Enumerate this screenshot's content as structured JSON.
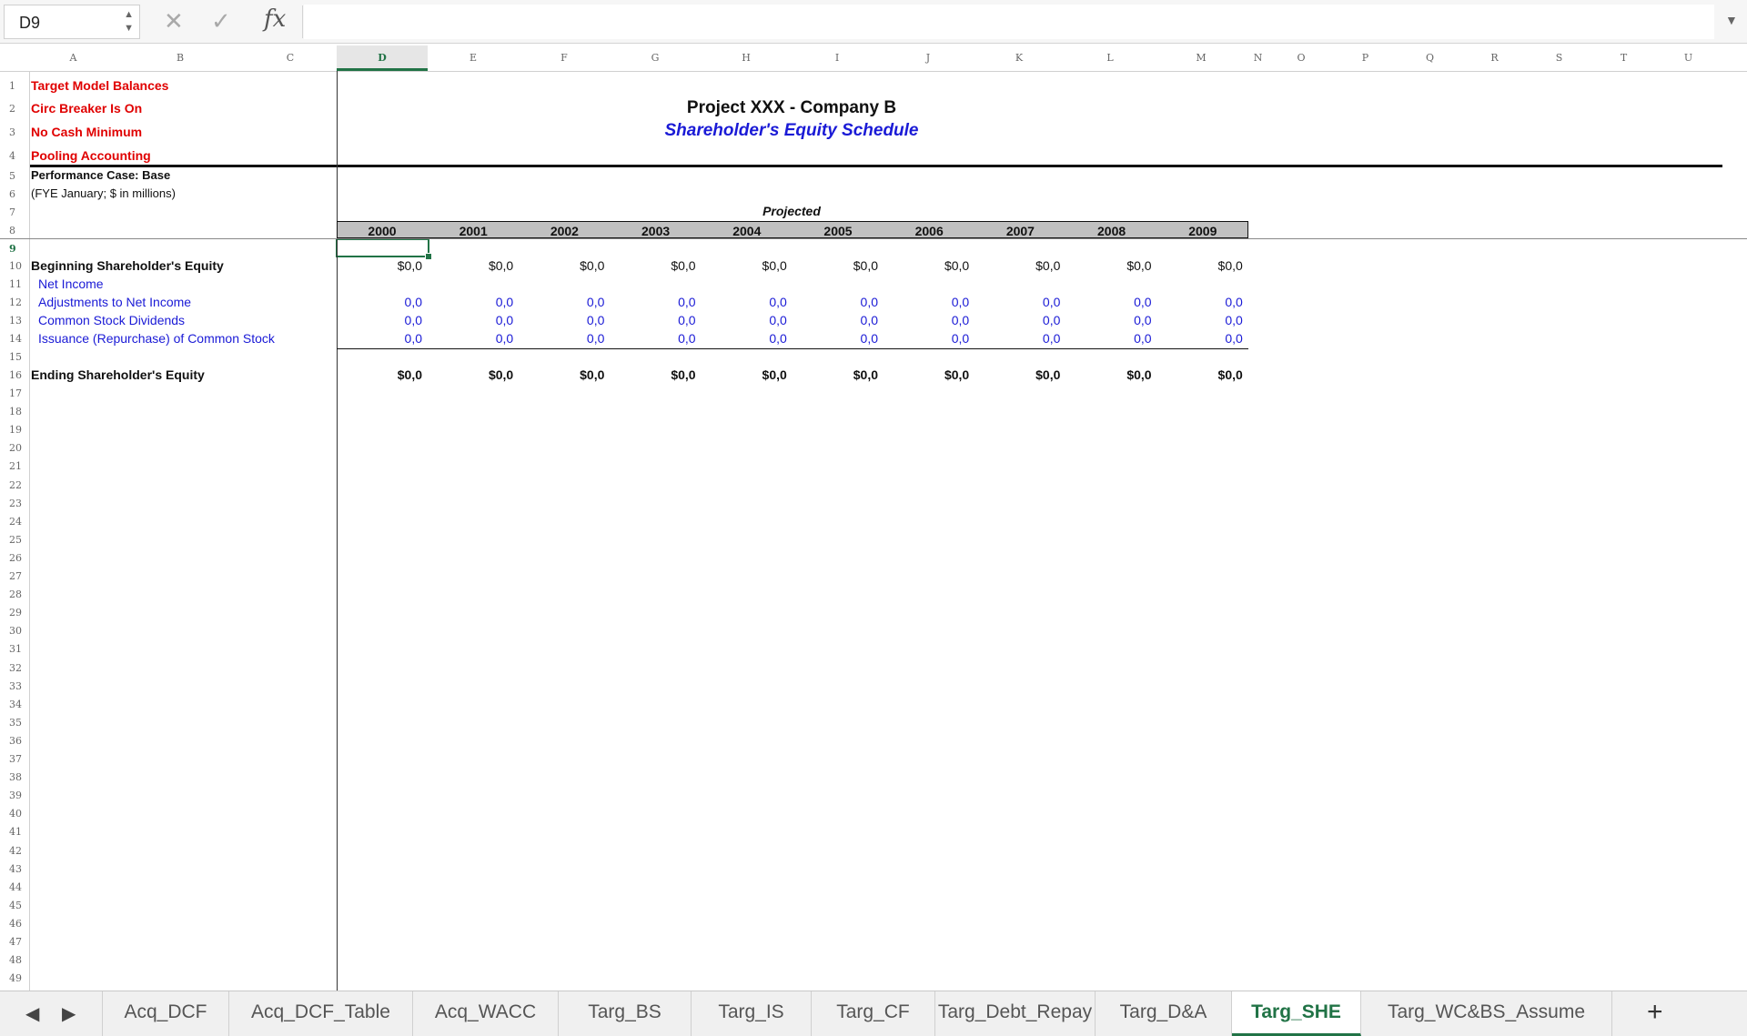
{
  "formula_bar": {
    "name_box": "D9",
    "cancel_icon": "close-icon",
    "enter_icon": "check-icon",
    "fx_label": "fx",
    "formula": ""
  },
  "grid": {
    "columns": [
      "A",
      "B",
      "C",
      "D",
      "E",
      "F",
      "G",
      "H",
      "I",
      "J",
      "K",
      "L",
      "M",
      "N",
      "O",
      "P",
      "Q",
      "R",
      "S",
      "T",
      "U"
    ],
    "selected_column": "D",
    "selected_row": "9",
    "rows": [
      "1",
      "2",
      "3",
      "4",
      "5",
      "6",
      "7",
      "8",
      "9",
      "10",
      "11",
      "12",
      "13",
      "14",
      "15",
      "16",
      "17",
      "18",
      "19",
      "20",
      "21",
      "22",
      "23",
      "24",
      "25",
      "26",
      "27",
      "28",
      "29",
      "30",
      "31",
      "32",
      "33",
      "34",
      "35",
      "36",
      "37",
      "38",
      "39",
      "40",
      "41",
      "42",
      "43",
      "44",
      "45",
      "46",
      "47",
      "48",
      "49"
    ]
  },
  "sheet": {
    "flags": [
      "Target Model Balances",
      "Circ Breaker Is On",
      "No Cash Minimum",
      "Pooling Accounting"
    ],
    "performance_case": "Performance Case: Base",
    "fye_note": "(FYE January; $ in millions)",
    "title": "Project XXX - Company B",
    "subtitle": "Shareholder's Equity Schedule",
    "projected_label": "Projected",
    "years": [
      "2000",
      "2001",
      "2002",
      "2003",
      "2004",
      "2005",
      "2006",
      "2007",
      "2008",
      "2009"
    ],
    "beginning_label": "Beginning Shareholder's Equity",
    "beginning_values": [
      "$0,0",
      "$0,0",
      "$0,0",
      "$0,0",
      "$0,0",
      "$0,0",
      "$0,0",
      "$0,0",
      "$0,0",
      "$0,0"
    ],
    "line_items": [
      {
        "label": "Net Income",
        "values": []
      },
      {
        "label": "Adjustments to Net Income",
        "values": [
          "0,0",
          "0,0",
          "0,0",
          "0,0",
          "0,0",
          "0,0",
          "0,0",
          "0,0",
          "0,0",
          "0,0"
        ]
      },
      {
        "label": "Common Stock Dividends",
        "values": [
          "0,0",
          "0,0",
          "0,0",
          "0,0",
          "0,0",
          "0,0",
          "0,0",
          "0,0",
          "0,0",
          "0,0"
        ]
      },
      {
        "label": "Issuance (Repurchase) of Common Stock",
        "values": [
          "0,0",
          "0,0",
          "0,0",
          "0,0",
          "0,0",
          "0,0",
          "0,0",
          "0,0",
          "0,0",
          "0,0"
        ]
      }
    ],
    "ending_label": "Ending Shareholder's Equity",
    "ending_values": [
      "$0,0",
      "$0,0",
      "$0,0",
      "$0,0",
      "$0,0",
      "$0,0",
      "$0,0",
      "$0,0",
      "$0,0",
      "$0,0"
    ]
  },
  "tabs": {
    "items": [
      "Acq_DCF",
      "Acq_DCF_Table",
      "Acq_WACC",
      "Targ_BS",
      "Targ_IS",
      "Targ_CF",
      "Targ_Debt_Repay",
      "Targ_D&A",
      "Targ_SHE",
      "Targ_WC&BS_Assume"
    ],
    "active": "Targ_SHE",
    "add_label": "+"
  },
  "colors": {
    "accent": "#217346",
    "flag_red": "#e00000",
    "input_blue": "#1a1ad6"
  }
}
